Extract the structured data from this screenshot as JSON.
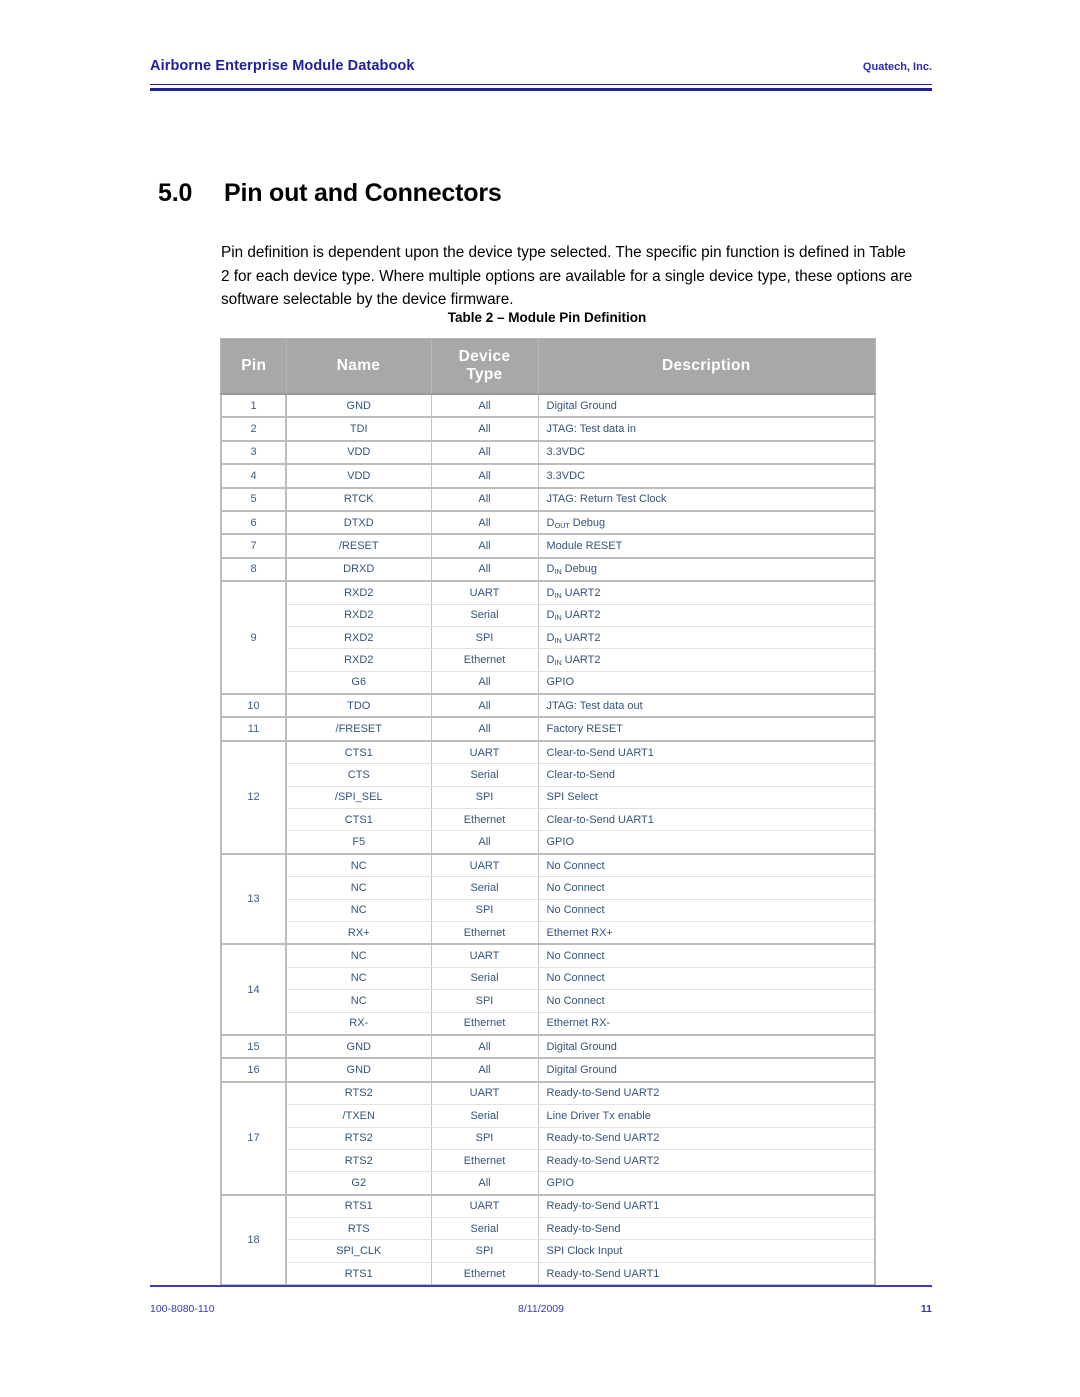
{
  "header": {
    "title": "Airborne Enterprise Module Databook",
    "company": "Quatech, Inc."
  },
  "section": {
    "number": "5.0",
    "title": "Pin out and Connectors",
    "paragraph": "Pin definition is dependent upon the device type selected. The specific pin function is defined in Table 2 for each device type. Where multiple options are available for a single device type, these options are software selectable by the device firmware."
  },
  "table": {
    "caption": "Table 2 – Module Pin Definition",
    "columns": [
      "Pin",
      "Name",
      "Device Type",
      "Description"
    ],
    "column_header_lines": {
      "pin": "Pin",
      "name": "Name",
      "device_type_line1": "Device",
      "device_type_line2": "Type",
      "description": "Description"
    },
    "groups": [
      {
        "pin": "1",
        "rows": [
          {
            "name": "GND",
            "device": "All",
            "desc": "Digital Ground"
          }
        ]
      },
      {
        "pin": "2",
        "rows": [
          {
            "name": "TDI",
            "device": "All",
            "desc": "JTAG: Test data in"
          }
        ]
      },
      {
        "pin": "3",
        "rows": [
          {
            "name": "VDD",
            "device": "All",
            "desc": "3.3VDC"
          }
        ]
      },
      {
        "pin": "4",
        "rows": [
          {
            "name": "VDD",
            "device": "All",
            "desc": "3.3VDC"
          }
        ]
      },
      {
        "pin": "5",
        "rows": [
          {
            "name": "RTCK",
            "device": "All",
            "desc": "JTAG: Return Test Clock"
          }
        ]
      },
      {
        "pin": "6",
        "rows": [
          {
            "name": "DTXD",
            "device": "All",
            "desc": "D",
            "desc_sub": "OUT",
            "desc_tail": " Debug"
          }
        ]
      },
      {
        "pin": "7",
        "rows": [
          {
            "name": "/RESET",
            "device": "All",
            "desc": "Module RESET"
          }
        ]
      },
      {
        "pin": "8",
        "rows": [
          {
            "name": "DRXD",
            "device": "All",
            "desc": "D",
            "desc_sub": "IN",
            "desc_tail": " Debug"
          }
        ]
      },
      {
        "pin": "9",
        "rows": [
          {
            "name": "RXD2",
            "device": "UART",
            "desc": "D",
            "desc_sub": "IN",
            "desc_tail": " UART2"
          },
          {
            "name": "RXD2",
            "device": "Serial",
            "desc": "D",
            "desc_sub": "IN",
            "desc_tail": " UART2"
          },
          {
            "name": "RXD2",
            "device": "SPI",
            "desc": "D",
            "desc_sub": "IN",
            "desc_tail": " UART2"
          },
          {
            "name": "RXD2",
            "device": "Ethernet",
            "desc": "D",
            "desc_sub": "IN",
            "desc_tail": " UART2"
          },
          {
            "name": "G6",
            "device": "All",
            "desc": "GPIO"
          }
        ]
      },
      {
        "pin": "10",
        "rows": [
          {
            "name": "TDO",
            "device": "All",
            "desc": "JTAG: Test data out"
          }
        ]
      },
      {
        "pin": "11",
        "rows": [
          {
            "name": "/FRESET",
            "device": "All",
            "desc": "Factory RESET"
          }
        ]
      },
      {
        "pin": "12",
        "rows": [
          {
            "name": "CTS1",
            "device": "UART",
            "desc": "Clear-to-Send UART1"
          },
          {
            "name": "CTS",
            "device": "Serial",
            "desc": "Clear-to-Send"
          },
          {
            "name": "/SPI_SEL",
            "device": "SPI",
            "desc": "SPI Select"
          },
          {
            "name": "CTS1",
            "device": "Ethernet",
            "desc": "Clear-to-Send UART1"
          },
          {
            "name": "F5",
            "device": "All",
            "desc": "GPIO"
          }
        ]
      },
      {
        "pin": "13",
        "rows": [
          {
            "name": "NC",
            "device": "UART",
            "desc": "No Connect"
          },
          {
            "name": "NC",
            "device": "Serial",
            "desc": "No Connect"
          },
          {
            "name": "NC",
            "device": "SPI",
            "desc": "No Connect"
          },
          {
            "name": "RX+",
            "device": "Ethernet",
            "desc": "Ethernet RX+"
          }
        ]
      },
      {
        "pin": "14",
        "rows": [
          {
            "name": "NC",
            "device": "UART",
            "desc": "No Connect"
          },
          {
            "name": "NC",
            "device": "Serial",
            "desc": "No Connect"
          },
          {
            "name": "NC",
            "device": "SPI",
            "desc": "No Connect"
          },
          {
            "name": "RX-",
            "device": "Ethernet",
            "desc": "Ethernet RX-"
          }
        ]
      },
      {
        "pin": "15",
        "rows": [
          {
            "name": "GND",
            "device": "All",
            "desc": "Digital Ground"
          }
        ]
      },
      {
        "pin": "16",
        "rows": [
          {
            "name": "GND",
            "device": "All",
            "desc": "Digital Ground"
          }
        ]
      },
      {
        "pin": "17",
        "rows": [
          {
            "name": "RTS2",
            "device": "UART",
            "desc": "Ready-to-Send UART2"
          },
          {
            "name": "/TXEN",
            "device": "Serial",
            "desc": "Line Driver Tx enable"
          },
          {
            "name": "RTS2",
            "device": "SPI",
            "desc": "Ready-to-Send UART2"
          },
          {
            "name": "RTS2",
            "device": "Ethernet",
            "desc": "Ready-to-Send UART2"
          },
          {
            "name": "G2",
            "device": "All",
            "desc": "GPIO"
          }
        ]
      },
      {
        "pin": "18",
        "rows": [
          {
            "name": "RTS1",
            "device": "UART",
            "desc": "Ready-to-Send UART1"
          },
          {
            "name": "RTS",
            "device": "Serial",
            "desc": "Ready-to-Send"
          },
          {
            "name": "SPI_CLK",
            "device": "SPI",
            "desc": "SPI Clock Input"
          },
          {
            "name": "RTS1",
            "device": "Ethernet",
            "desc": "Ready-to-Send UART1"
          }
        ]
      }
    ]
  },
  "footer": {
    "doc_number": "100-8080-110",
    "date": "8/11/2009",
    "page": "11"
  },
  "colors": {
    "header_blue": "#21219c",
    "table_header_gray": "#a8a8a8",
    "table_text_blue": "#33547d",
    "footer_blue": "#3737b5"
  }
}
